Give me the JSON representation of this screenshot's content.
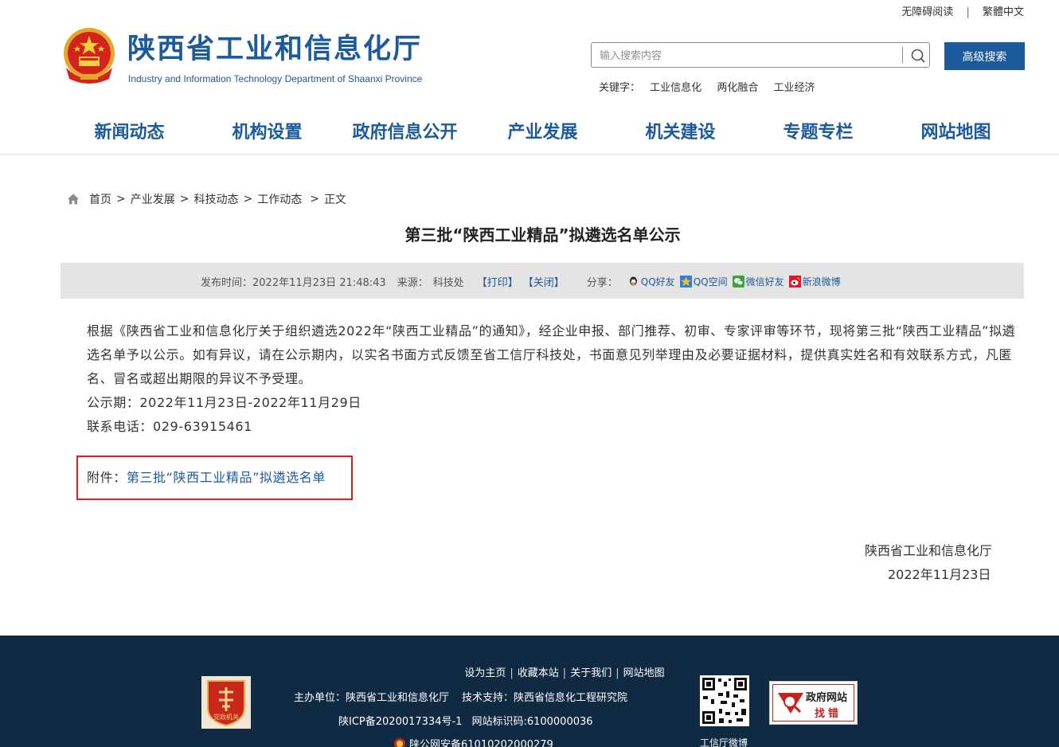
{
  "topbar": {
    "accessible": "无障碍阅读",
    "separator": "|",
    "traditional": "繁體中文"
  },
  "site": {
    "title": "陕西省工业和信息化厅",
    "subtitle": "Industry and Information Technology Department of Shaanxi Province"
  },
  "search": {
    "placeholder": "输入搜索内容",
    "advanced_label": "高级搜索"
  },
  "keywords": {
    "label": "关键字：",
    "items": [
      "工业信息化",
      "两化融合",
      "工业经济"
    ]
  },
  "nav": {
    "items": [
      "新闻动态",
      "机构设置",
      "政府信息公开",
      "产业发展",
      "机关建设",
      "专题专栏",
      "网站地图"
    ]
  },
  "breadcrumb": {
    "items": [
      "首页",
      "产业发展",
      "科技动态",
      "工作动态",
      "正文"
    ],
    "sep": ">"
  },
  "article": {
    "title": "第三批“陕西工业精品”拟遴选名单公示",
    "meta": {
      "publish_label": "发布时间：",
      "publish_time": "2022年11月23日 21:48:43",
      "source_label": "来源：",
      "source": "科技处",
      "print": "【打印】",
      "close": "【关闭】",
      "share_label": "分享：",
      "share": [
        "QQ好友",
        "QQ空间",
        "微信好友",
        "新浪微博"
      ]
    },
    "paragraph": "根据《陕西省工业和信息化厅关于组织遴选2022年“陕西工业精品”的通知》，经企业申报、部门推荐、初审、专家评审等环节，现将第三批“陕西工业精品”拟遴选名单予以公示。如有异议，请在公示期内，以实名书面方式反馈至省工信厅科技处，书面意见列举理由及必要证据材料，提供真实姓名和有效联系方式，凡匿名、冒名或超出期限的异议不予受理。",
    "period": "公示期：2022年11月23日-2022年11月29日",
    "phone": "联系电话：029-63915461",
    "attachment_label": "附件：",
    "attachment_link": "第三批“陕西工业精品”拟遴选名单",
    "sign_org": "陕西省工业和信息化厅",
    "sign_date": "2022年11月23日"
  },
  "footer": {
    "links": [
      "设为主页",
      "收藏本站",
      "关于我们",
      "网站地图"
    ],
    "link_sep": "|",
    "host": "主办单位：陕西省工业和信息化厅",
    "tech": "技术支持：陕西省信息化工程研究院",
    "icp": "陕ICP备2020017334号-1",
    "site_code": "网站标识码:6100000036",
    "police": "陕公网安备61010202000279",
    "badge_text": "党政机关",
    "qr_label": "工信厅微博",
    "gov_error_line1": "政府网站",
    "gov_error_line2": "找错"
  },
  "colors": {
    "brand_blue": "#1c5a9c",
    "footer_bg": "#0f2a42",
    "highlight_red": "#e01b1b"
  }
}
